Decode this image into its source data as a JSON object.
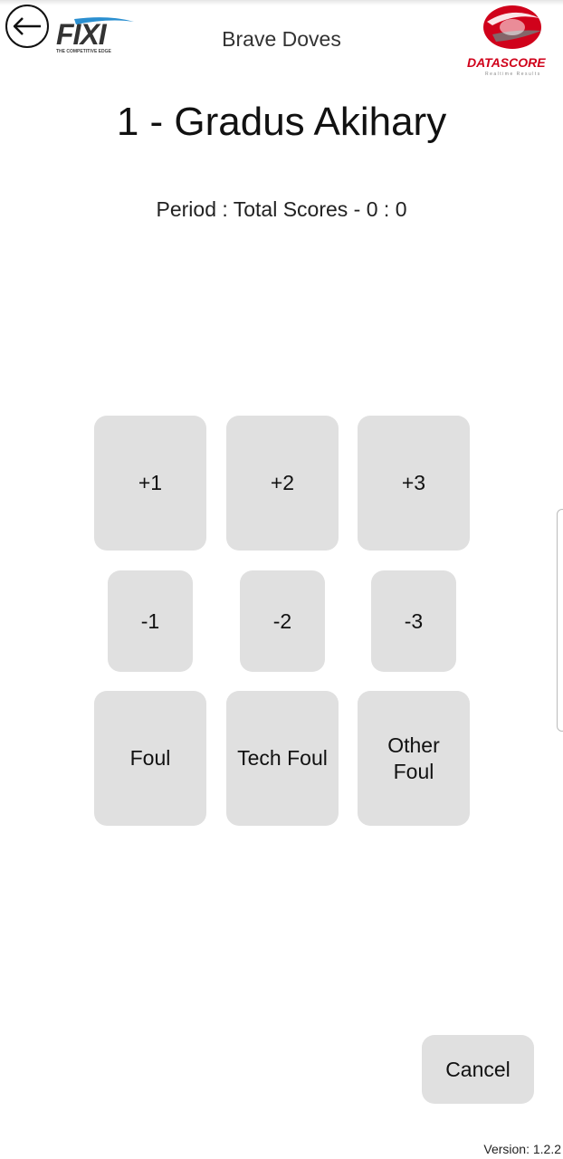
{
  "header": {
    "back_icon": "arrow-left-icon",
    "left_logo": "fixi-logo",
    "left_logo_text": "FIXI",
    "left_logo_tagline": "THE COMPETITIVE EDGE",
    "title": "Brave Doves",
    "right_logo": "datascore-logo",
    "right_logo_text": "DATASCORE",
    "right_logo_tagline": "Realtime Results",
    "accent_color": "#d0021b"
  },
  "player": {
    "title": "1 - Gradus Akihary"
  },
  "score": {
    "period_text": "Period : Total Scores - 0 : 0"
  },
  "actions": {
    "add": [
      "+1",
      "+2",
      "+3"
    ],
    "subtract": [
      "-1",
      "-2",
      "-3"
    ],
    "fouls": [
      "Foul",
      "Tech Foul",
      "Other Foul"
    ]
  },
  "footer": {
    "cancel_label": "Cancel",
    "version": "Version: 1.2.2"
  },
  "colors": {
    "button_bg": "#e0e0e0",
    "text": "#111111",
    "background": "#ffffff"
  }
}
